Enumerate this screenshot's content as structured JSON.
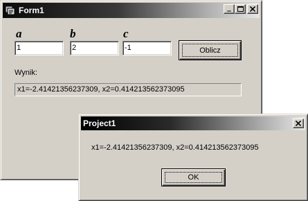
{
  "form1": {
    "title": "Form1",
    "minimize": "_",
    "maximize": "□",
    "close": "✕",
    "label_a": "a",
    "label_b": "b",
    "label_c": "c",
    "input_a": "1",
    "input_b": "2",
    "input_c": "-1",
    "button_label": "Oblicz",
    "result_label": "Wynik:",
    "result_value": "x1=-2.41421356237309,  x2=0.414213562373095"
  },
  "dialog": {
    "title": "Project1",
    "close": "✕",
    "message": "x1=-2.41421356237309,  x2=0.414213562373095",
    "ok_label": "OK"
  }
}
